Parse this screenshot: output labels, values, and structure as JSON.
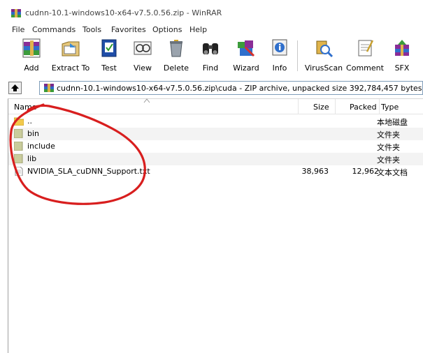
{
  "window": {
    "title": "cudnn-10.1-windows10-x64-v7.5.0.56.zip - WinRAR",
    "app_icon": "winrar-icon"
  },
  "menu": [
    "File",
    "Commands",
    "Tools",
    "Favorites",
    "Options",
    "Help"
  ],
  "toolbar": {
    "buttons": [
      {
        "label": "Add",
        "icon": "add-archive-icon"
      },
      {
        "label": "Extract To",
        "icon": "extract-to-icon"
      },
      {
        "label": "Test",
        "icon": "test-icon"
      },
      {
        "label": "View",
        "icon": "view-icon"
      },
      {
        "label": "Delete",
        "icon": "delete-icon"
      },
      {
        "label": "Find",
        "icon": "find-icon"
      },
      {
        "label": "Wizard",
        "icon": "wizard-icon"
      },
      {
        "label": "Info",
        "icon": "info-icon"
      },
      {
        "label": "VirusScan",
        "icon": "virusscan-icon"
      },
      {
        "label": "Comment",
        "icon": "comment-icon"
      },
      {
        "label": "SFX",
        "icon": "sfx-icon"
      }
    ]
  },
  "address": {
    "path": "cudnn-10.1-windows10-x64-v7.5.0.56.zip\\cuda - ZIP archive, unpacked size 392,784,457 bytes",
    "up_icon": "up-folder-icon"
  },
  "columns": {
    "name": "Name",
    "size": "Size",
    "packed": "Packed",
    "type": "Type"
  },
  "files": [
    {
      "name": "..",
      "size": "",
      "packed": "",
      "type": "本地磁盘",
      "icon": "parent-folder-icon"
    },
    {
      "name": "bin",
      "size": "",
      "packed": "",
      "type": "文件夹",
      "icon": "folder-icon"
    },
    {
      "name": "include",
      "size": "",
      "packed": "",
      "type": "文件夹",
      "icon": "folder-icon"
    },
    {
      "name": "lib",
      "size": "",
      "packed": "",
      "type": "文件夹",
      "icon": "folder-icon"
    },
    {
      "name": "NVIDIA_SLA_cuDNN_Support.txt",
      "size": "38,963",
      "packed": "12,962",
      "type": "文本文档",
      "icon": "text-file-icon"
    }
  ],
  "colors": {
    "annotation": "#d81e1e",
    "row_alt": "#f3f3f3"
  }
}
